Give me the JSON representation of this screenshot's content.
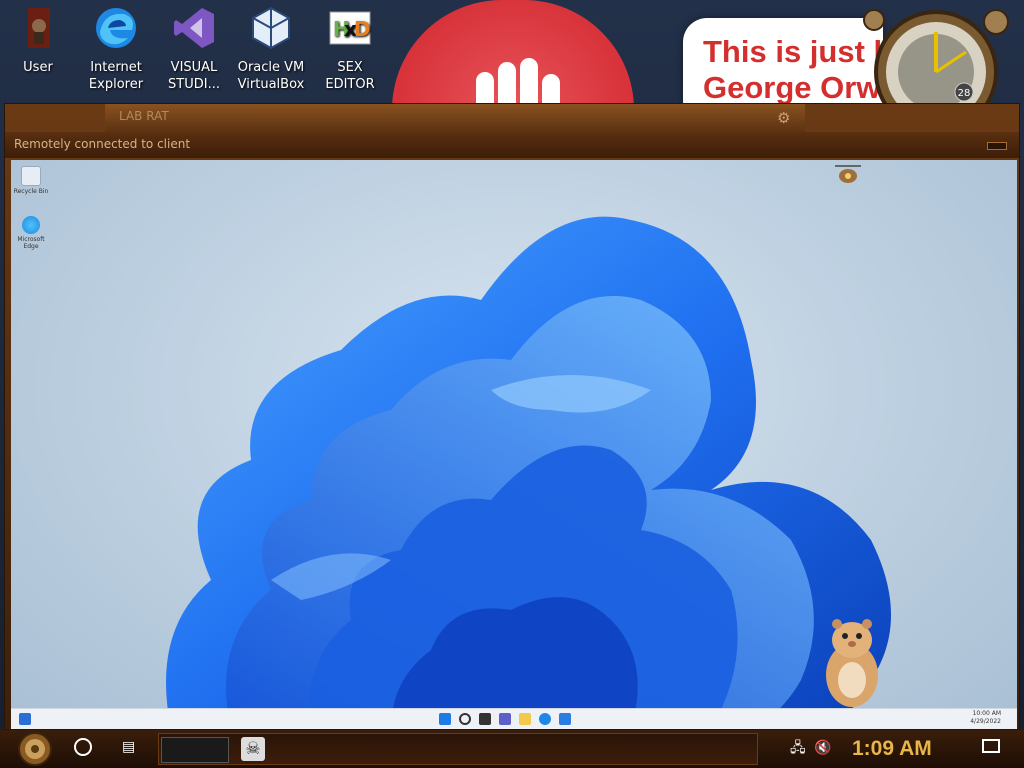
{
  "desktop": {
    "icons": [
      {
        "label": "User",
        "icon": "user-folder-icon"
      },
      {
        "label": "Internet\nExplorer",
        "icon": "edge-icon"
      },
      {
        "label": "VISUAL\nSTUDI...",
        "icon": "visual-studio-icon"
      },
      {
        "label": "Oracle VM\nVirtualBox",
        "icon": "virtualbox-icon"
      },
      {
        "label": "SEX\nEDITOR",
        "icon": "hex-editor-icon"
      }
    ],
    "note_widget": {
      "line1": "This is just like",
      "line2": "George Orwell"
    },
    "clock_widget": {
      "date_number": "28"
    }
  },
  "rat_window": {
    "title": "LAB RAT",
    "status": "Remotely connected to client",
    "remote_screen": {
      "desktop_icons": [
        {
          "label": "Recycle Bin",
          "icon": "recycle-bin-icon"
        },
        {
          "label": "Microsoft Edge",
          "icon": "edge-icon"
        }
      ],
      "taskbar_time": "10:00 AM",
      "taskbar_date": "4/29/2022"
    }
  },
  "host_taskbar": {
    "time": "1:09 AM",
    "icons": [
      "start-orb-icon",
      "cortana-circle-icon",
      "task-view-icon",
      "skull-app-icon",
      "network-icon",
      "volume-muted-icon",
      "notification-icon"
    ]
  },
  "colors": {
    "rat_frame": "#5b3312",
    "clock_text": "#e8b548",
    "note_text": "#d32f2f",
    "remote_wallpaper_blue": "#1f6ff0"
  }
}
